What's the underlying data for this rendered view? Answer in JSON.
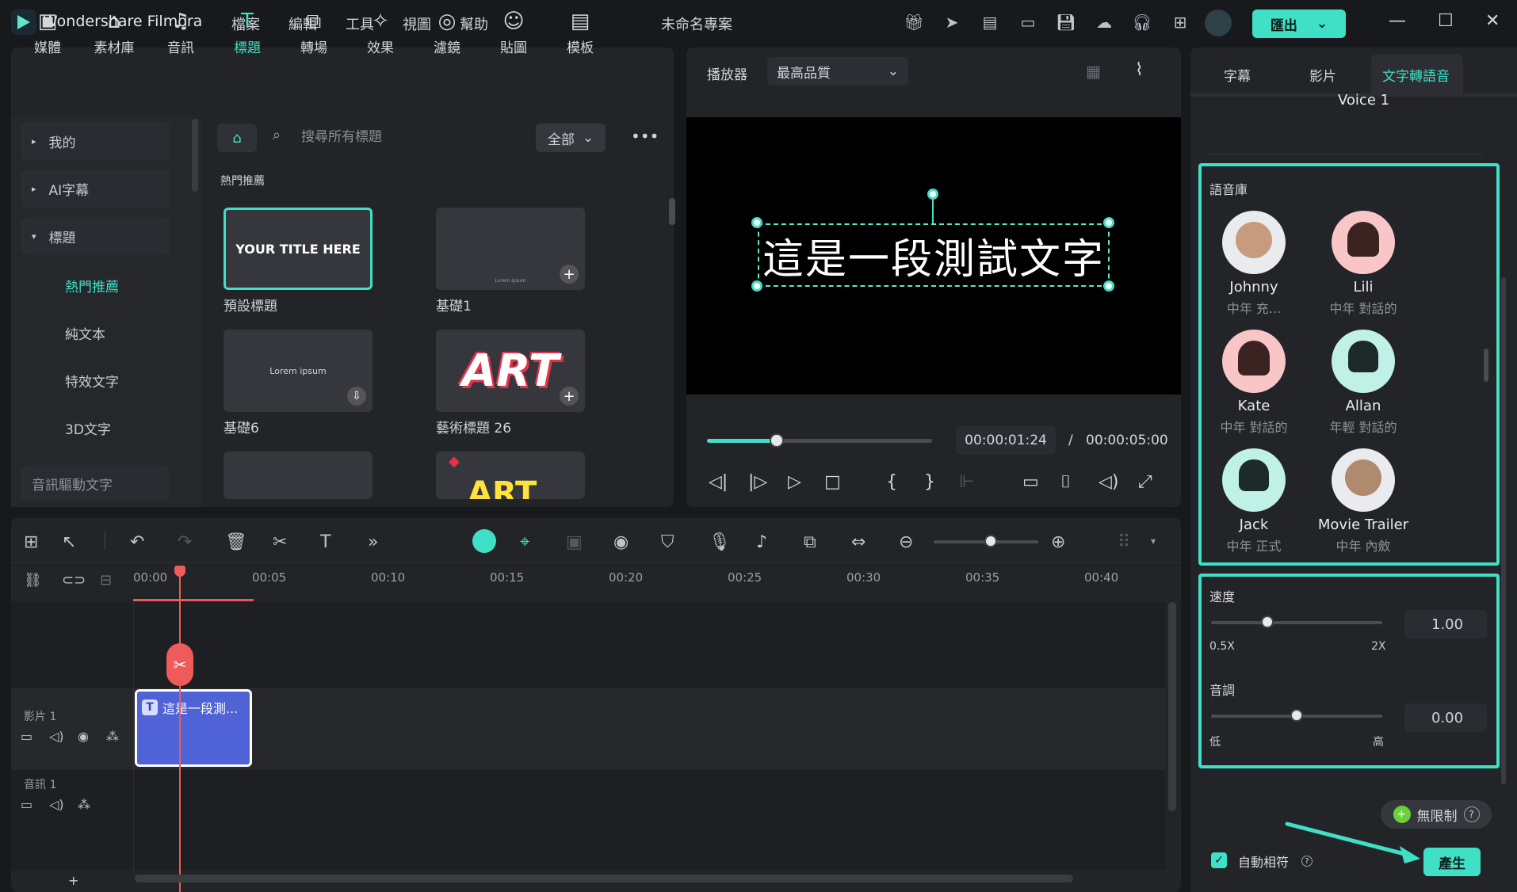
{
  "app": {
    "name": "Wondershare Filmora",
    "project_title": "未命名專案",
    "export_label": "匯出"
  },
  "menu": [
    "檔案",
    "編輯",
    "工具",
    "視圖",
    "幫助"
  ],
  "media_tabs": [
    {
      "label": "媒體",
      "icon": "media-icon"
    },
    {
      "label": "素材庫",
      "icon": "stock-icon"
    },
    {
      "label": "音訊",
      "icon": "music-icon"
    },
    {
      "label": "標題",
      "icon": "title-icon"
    },
    {
      "label": "轉場",
      "icon": "transition-icon"
    },
    {
      "label": "效果",
      "icon": "effects-icon"
    },
    {
      "label": "濾鏡",
      "icon": "filters-icon"
    },
    {
      "label": "貼圖",
      "icon": "sticker-icon"
    },
    {
      "label": "模板",
      "icon": "template-icon"
    }
  ],
  "sidebar": {
    "items": [
      "我的",
      "AI字幕",
      "標題"
    ],
    "subitems": [
      "熱門推薦",
      "純文本",
      "特效文字",
      "3D文字"
    ],
    "bottom_item": "音訊驅動文字"
  },
  "search": {
    "placeholder": "搜尋所有標題",
    "filter": "全部"
  },
  "section_title": "熱門推薦",
  "thumbnails": [
    {
      "label": "預設標題",
      "preview": "YOUR TITLE HERE"
    },
    {
      "label": "基礎1",
      "preview": "Lorem ipsum"
    },
    {
      "label": "基礎6",
      "preview": "Lorem ipsum"
    },
    {
      "label": "藝術標題 26",
      "preview": "ART"
    },
    {
      "label": "",
      "preview": ""
    },
    {
      "label": "",
      "preview": "ART"
    }
  ],
  "player": {
    "label": "播放器",
    "quality": "最高品質",
    "caption": "這是一段測試文字",
    "current_time": "00:00:01:24",
    "separator": "/",
    "total_time": "00:00:05:00",
    "progress": 0.31
  },
  "props": {
    "tabs": [
      "字幕",
      "影片",
      "文字轉語音"
    ],
    "voice_header": "Voice 1",
    "library_title": "語音庫",
    "voices": [
      {
        "name": "Johnny",
        "desc": "中年 充...",
        "tone": "#e9ebee"
      },
      {
        "name": "Lili",
        "desc": "中年 對話的",
        "tone": "#f9c6c8"
      },
      {
        "name": "Kate",
        "desc": "中年 對話的",
        "tone": "#f9c6c8"
      },
      {
        "name": "Allan",
        "desc": "年輕 對話的",
        "tone": "#bff1e6"
      },
      {
        "name": "Jack",
        "desc": "中年 正式",
        "tone": "#bff1e6"
      },
      {
        "name": "Movie Trailer",
        "desc": "中年 內斂",
        "tone": "#e9ebee"
      }
    ],
    "speed": {
      "label": "速度",
      "value": "1.00",
      "min": "0.5X",
      "max": "2X",
      "level": 0.33
    },
    "pitch": {
      "label": "音調",
      "value": "0.00",
      "min": "低",
      "max": "高",
      "level": 0.5
    },
    "unlimited": "無限制",
    "auto_match": "自動相符",
    "generate": "產生"
  },
  "timeline": {
    "ruler": [
      "00:00",
      "00:05",
      "00:10",
      "00:15",
      "00:20",
      "00:25",
      "00:30",
      "00:35",
      "00:40"
    ],
    "tracks": [
      "影片 1",
      "音訊 1"
    ],
    "clip_label": "這是一段測...",
    "add_label": "+"
  }
}
